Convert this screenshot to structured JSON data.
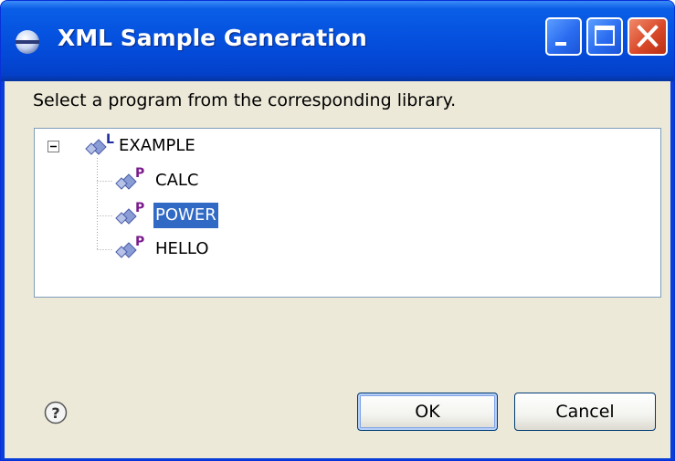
{
  "window": {
    "title": "XML Sample Generation",
    "title_icon": "eclipse-icon"
  },
  "titlebar_buttons": {
    "minimize": "minimize-icon",
    "maximize": "maximize-icon",
    "close": "close-icon"
  },
  "instruction": "Select a program from the corresponding library.",
  "tree": {
    "root": {
      "label": "EXAMPLE",
      "badge": "L",
      "expanded": true
    },
    "children": [
      {
        "label": "CALC",
        "badge": "P",
        "selected": false
      },
      {
        "label": "POWER",
        "badge": "P",
        "selected": true
      },
      {
        "label": "HELLO",
        "badge": "P",
        "selected": false
      }
    ]
  },
  "buttons": {
    "help_icon": "help-icon",
    "ok": "OK",
    "cancel": "Cancel"
  },
  "colors": {
    "titlebar": "#0553e0",
    "selection": "#316ac5",
    "dialog_bg": "#ece9d8",
    "library_badge": "#1c2c9c",
    "program_badge": "#7b1c8c"
  }
}
